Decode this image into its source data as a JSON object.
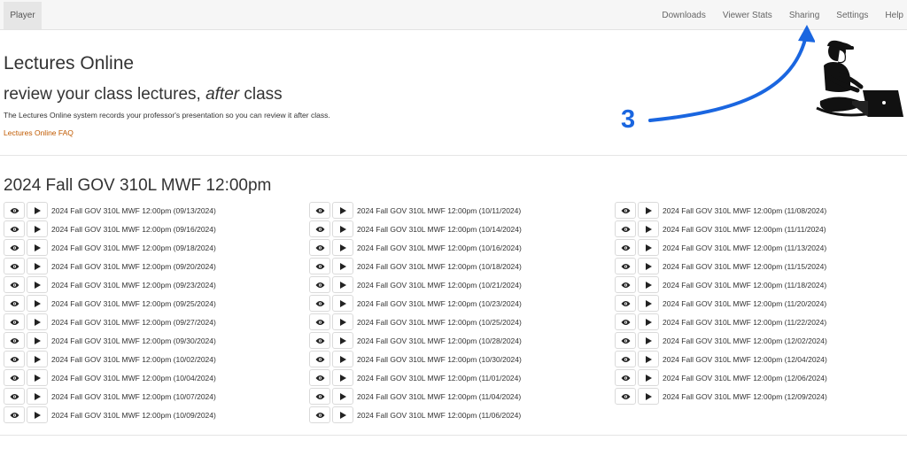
{
  "nav": {
    "brand": "Player",
    "links": [
      "Downloads",
      "Viewer Stats",
      "Sharing",
      "Settings",
      "Help"
    ]
  },
  "header": {
    "title": "Lectures Online",
    "subtitle_before": "review your class lectures, ",
    "subtitle_em": "after",
    "subtitle_after": " class",
    "description": "The Lectures Online system records your professor's presentation so you can review it after class.",
    "faq_link": "Lectures Online FAQ"
  },
  "annotation": {
    "step_number": "3",
    "color": "#1a66e0"
  },
  "course": {
    "title": "2024 Fall GOV 310L MWF 12:00pm",
    "columns": [
      [
        "2024 Fall GOV 310L MWF 12:00pm (09/13/2024)",
        "2024 Fall GOV 310L MWF 12:00pm (09/16/2024)",
        "2024 Fall GOV 310L MWF 12:00pm (09/18/2024)",
        "2024 Fall GOV 310L MWF 12:00pm (09/20/2024)",
        "2024 Fall GOV 310L MWF 12:00pm (09/23/2024)",
        "2024 Fall GOV 310L MWF 12:00pm (09/25/2024)",
        "2024 Fall GOV 310L MWF 12:00pm (09/27/2024)",
        "2024 Fall GOV 310L MWF 12:00pm (09/30/2024)",
        "2024 Fall GOV 310L MWF 12:00pm (10/02/2024)",
        "2024 Fall GOV 310L MWF 12:00pm (10/04/2024)",
        "2024 Fall GOV 310L MWF 12:00pm (10/07/2024)",
        "2024 Fall GOV 310L MWF 12:00pm (10/09/2024)"
      ],
      [
        "2024 Fall GOV 310L MWF 12:00pm (10/11/2024)",
        "2024 Fall GOV 310L MWF 12:00pm (10/14/2024)",
        "2024 Fall GOV 310L MWF 12:00pm (10/16/2024)",
        "2024 Fall GOV 310L MWF 12:00pm (10/18/2024)",
        "2024 Fall GOV 310L MWF 12:00pm (10/21/2024)",
        "2024 Fall GOV 310L MWF 12:00pm (10/23/2024)",
        "2024 Fall GOV 310L MWF 12:00pm (10/25/2024)",
        "2024 Fall GOV 310L MWF 12:00pm (10/28/2024)",
        "2024 Fall GOV 310L MWF 12:00pm (10/30/2024)",
        "2024 Fall GOV 310L MWF 12:00pm (11/01/2024)",
        "2024 Fall GOV 310L MWF 12:00pm (11/04/2024)",
        "2024 Fall GOV 310L MWF 12:00pm (11/06/2024)"
      ],
      [
        "2024 Fall GOV 310L MWF 12:00pm (11/08/2024)",
        "2024 Fall GOV 310L MWF 12:00pm (11/11/2024)",
        "2024 Fall GOV 310L MWF 12:00pm (11/13/2024)",
        "2024 Fall GOV 310L MWF 12:00pm (11/15/2024)",
        "2024 Fall GOV 310L MWF 12:00pm (11/18/2024)",
        "2024 Fall GOV 310L MWF 12:00pm (11/20/2024)",
        "2024 Fall GOV 310L MWF 12:00pm (11/22/2024)",
        "2024 Fall GOV 310L MWF 12:00pm (12/02/2024)",
        "2024 Fall GOV 310L MWF 12:00pm (12/04/2024)",
        "2024 Fall GOV 310L MWF 12:00pm (12/06/2024)",
        "2024 Fall GOV 310L MWF 12:00pm (12/09/2024)"
      ]
    ],
    "icons": {
      "view": "eye-icon",
      "play": "play-icon"
    }
  }
}
